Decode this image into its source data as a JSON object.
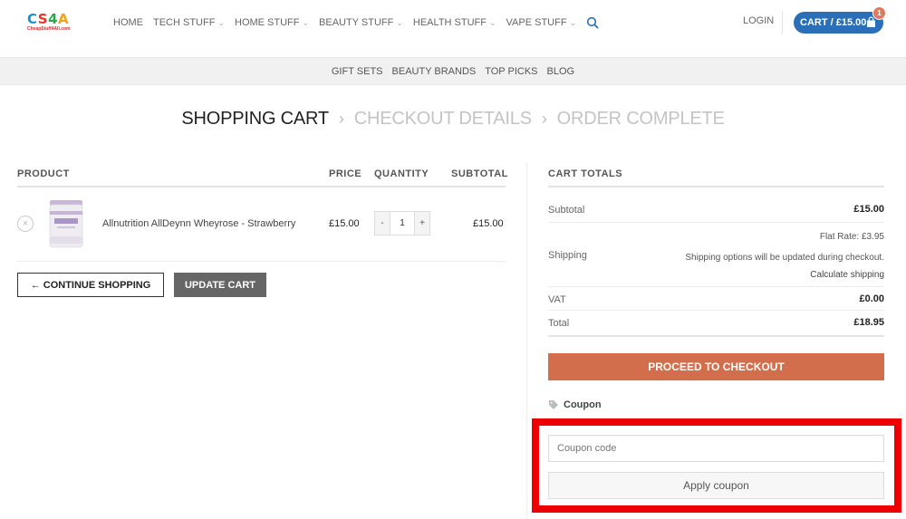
{
  "header": {
    "logo_text": "CS4A",
    "logo_sub": "CheapStuff4All.com",
    "nav": [
      {
        "label": "HOME",
        "has_dropdown": false
      },
      {
        "label": "TECH STUFF",
        "has_dropdown": true
      },
      {
        "label": "HOME STUFF",
        "has_dropdown": true
      },
      {
        "label": "BEAUTY STUFF",
        "has_dropdown": true
      },
      {
        "label": "HEALTH STUFF",
        "has_dropdown": true
      },
      {
        "label": "VAPE STUFF",
        "has_dropdown": true
      }
    ],
    "login_label": "LOGIN",
    "cart_label": "CART / £15.00",
    "cart_count": "1",
    "accent_color": "#2a6fb7"
  },
  "subnav": [
    "GIFT SETS",
    "BEAUTY BRANDS",
    "TOP PICKS",
    "BLOG"
  ],
  "steps": {
    "active": "SHOPPING CART",
    "step2": "CHECKOUT DETAILS",
    "step3": "ORDER COMPLETE"
  },
  "cart_table": {
    "headers": {
      "product": "PRODUCT",
      "price": "PRICE",
      "quantity": "QUANTITY",
      "subtotal": "SUBTOTAL"
    },
    "items": [
      {
        "name": "Allnutrition AllDeynn Wheyrose - Strawberry",
        "price": "£15.00",
        "quantity": "1",
        "subtotal": "£15.00",
        "remove_icon": "×"
      }
    ],
    "continue_label": "← CONTINUE SHOPPING",
    "update_label": "UPDATE CART"
  },
  "cart_totals": {
    "title": "CART TOTALS",
    "subtotal_label": "Subtotal",
    "subtotal_value": "£15.00",
    "shipping_label": "Shipping",
    "shipping_rate": "Flat Rate: £3.95",
    "shipping_note": "Shipping options will be updated during checkout.",
    "calc_shipping": "Calculate shipping",
    "vat_label": "VAT",
    "vat_value": "£0.00",
    "total_label": "Total",
    "total_value": "£18.95",
    "checkout_label": "PROCEED TO CHECKOUT",
    "checkout_color": "#d26e4b"
  },
  "coupon": {
    "heading": "Coupon",
    "placeholder": "Coupon code",
    "value": "",
    "apply_label": "Apply coupon",
    "highlight_color": "#ee0000"
  }
}
